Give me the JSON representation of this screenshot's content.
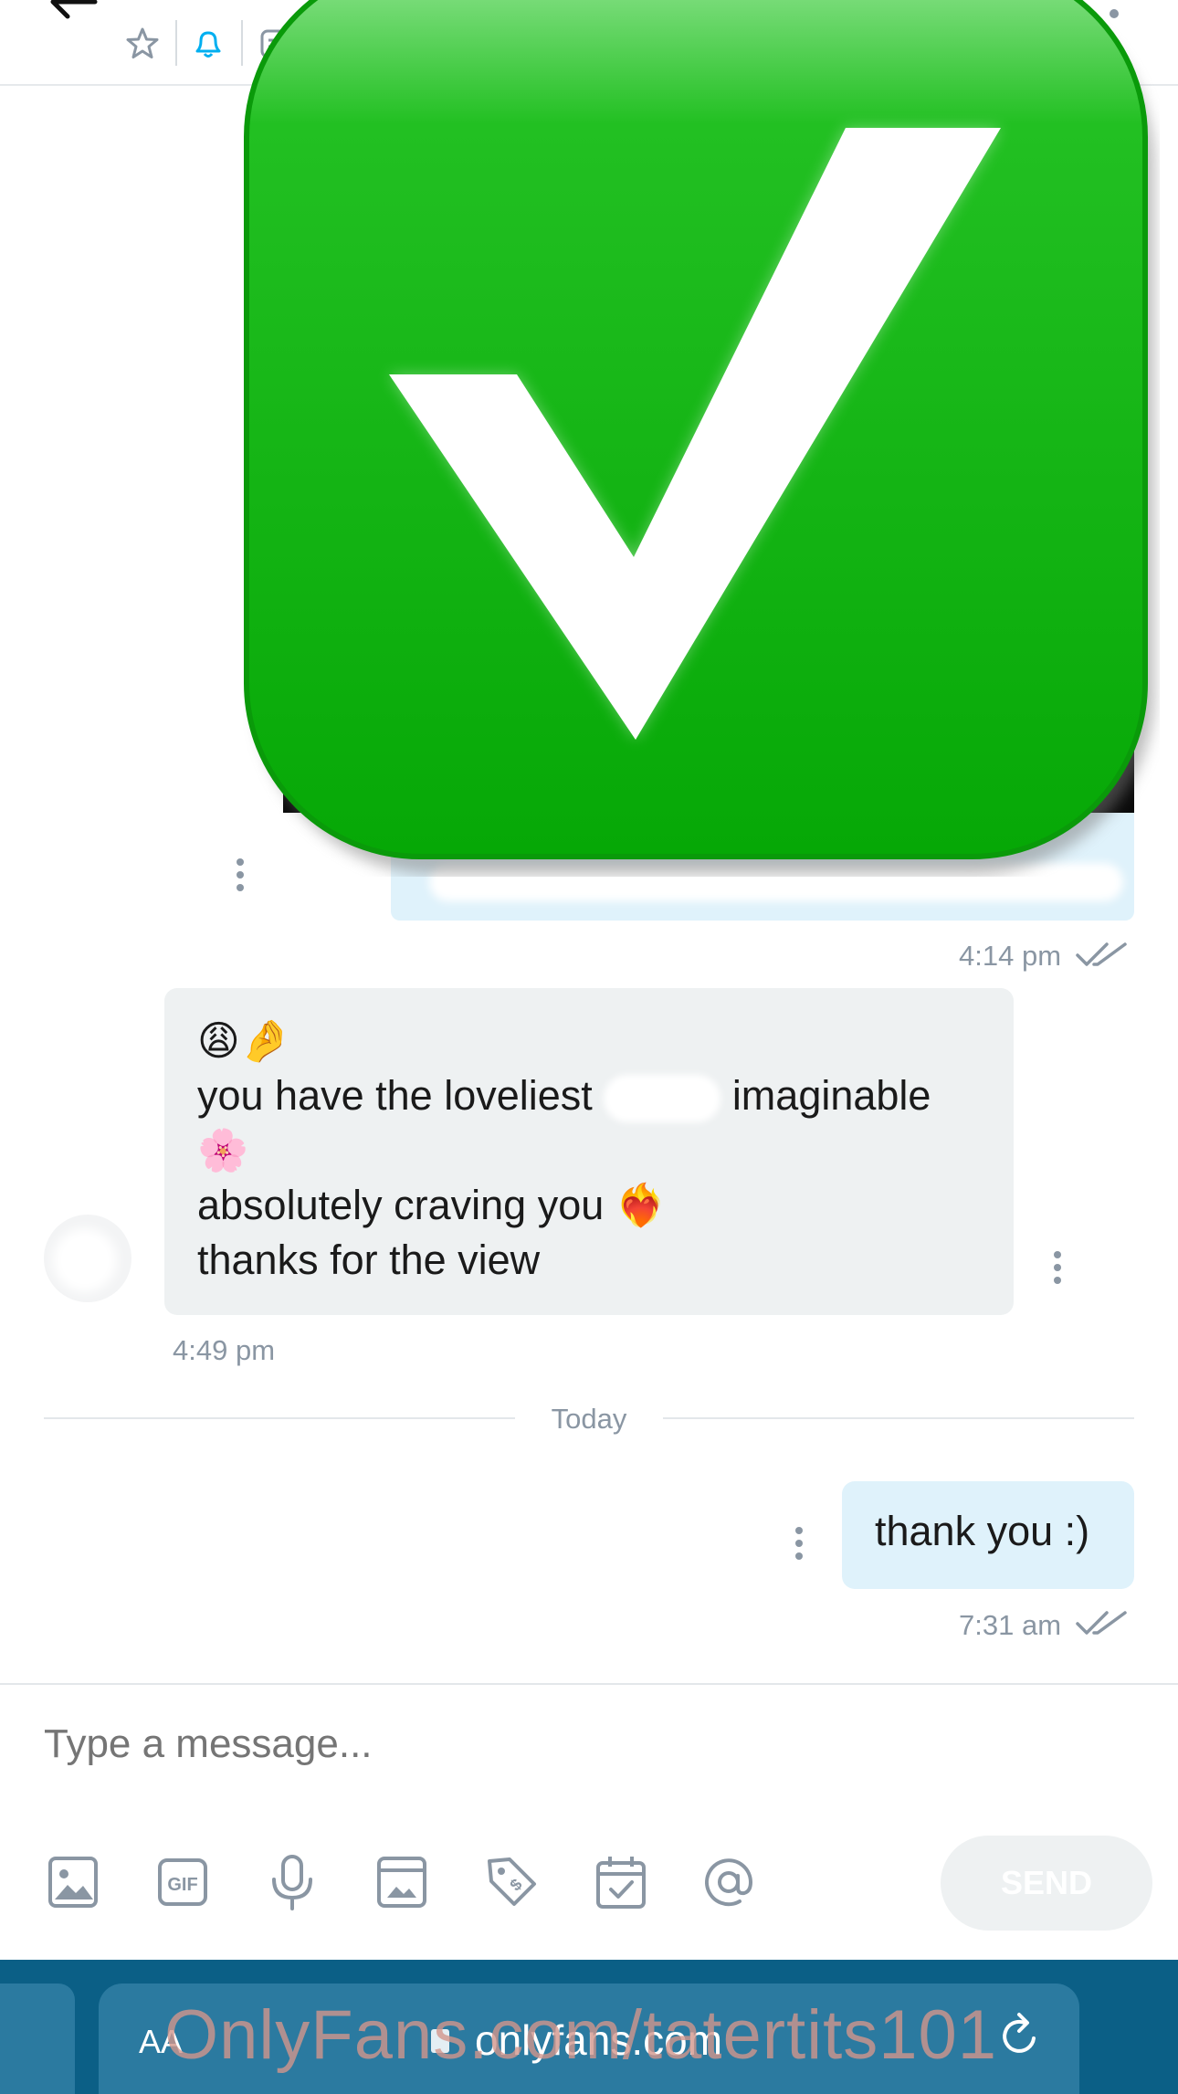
{
  "header": {
    "back_icon": "arrow-left-icon",
    "icons": [
      "star-icon",
      "bell-icon",
      "note-icon"
    ],
    "more_icon": "more-vertical-icon"
  },
  "overlay": {
    "icon": "green-checkmark-icon",
    "color": "#0fb40f"
  },
  "messages": [
    {
      "direction": "sent",
      "kind": "media",
      "time": "4:14 pm",
      "status_icon": "double-check-icon"
    },
    {
      "direction": "received",
      "kind": "text",
      "line1_emoji": "😩🤌",
      "line2_before": "you have the loveliest",
      "line2_after": "imaginable",
      "line3_emoji": "🌸",
      "line4": "absolutely craving you ❤️‍🔥",
      "line5": "thanks for the view",
      "time": "4:49 pm"
    },
    {
      "direction": "sent",
      "kind": "text",
      "text": "thank you :)",
      "time": "7:31 am",
      "status_icon": "double-check-icon"
    }
  ],
  "divider": {
    "label": "Today"
  },
  "composer": {
    "placeholder": "Type a message...",
    "tools": [
      "image-icon",
      "gif-icon",
      "microphone-icon",
      "vault-icon",
      "price-tag-icon",
      "calendar-icon",
      "mention-icon"
    ],
    "send_label": "SEND"
  },
  "browser": {
    "aa_label": "AA",
    "url": "onlyfans.com",
    "reload_icon": "reload-icon"
  },
  "watermark": "OnlyFans.com/tatertits101",
  "colors": {
    "accent": "#00aff0",
    "sent_bubble": "#dff2fb",
    "received_bubble": "#eef1f2",
    "browser_bar": "#0b5f86"
  }
}
